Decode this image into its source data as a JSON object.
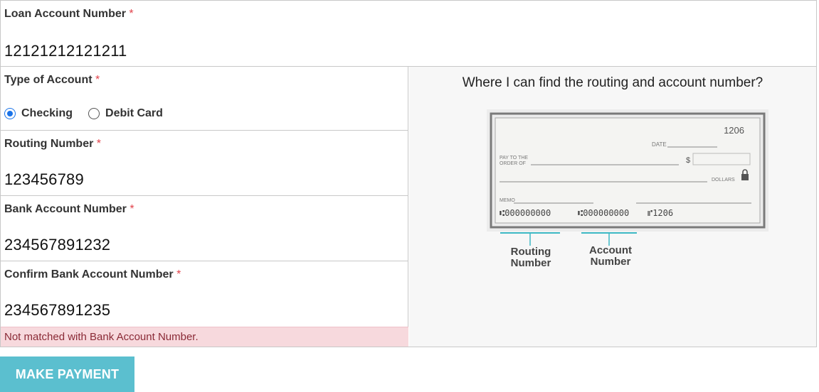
{
  "loan_account": {
    "label": "Loan Account Number",
    "required_mark": "*",
    "value": "12121212121211"
  },
  "account_type": {
    "label": "Type of Account",
    "required_mark": "*",
    "options": [
      {
        "label": "Checking",
        "checked": true
      },
      {
        "label": "Debit Card",
        "checked": false
      }
    ]
  },
  "routing": {
    "label": "Routing Number",
    "required_mark": "*",
    "value": "123456789"
  },
  "bank_account": {
    "label": "Bank Account Number",
    "required_mark": "*",
    "value": "234567891232"
  },
  "confirm_bank_account": {
    "label": "Confirm Bank Account Number",
    "required_mark": "*",
    "value": "234567891235",
    "error": "Not matched with Bank Account Number."
  },
  "help": {
    "title": "Where I can find the routing and account number?",
    "check": {
      "number": "1206",
      "date_label": "DATE",
      "pay_to_line1": "PAY TO THE",
      "pay_to_line2": "ORDER OF",
      "currency": "$",
      "dollars_label": "DOLLARS",
      "memo_label": "MEMO",
      "micr_routing": "⑆000000000",
      "micr_account": "⑆000000000",
      "micr_check": "⑈1206"
    },
    "routing_caption_1": "Routing",
    "routing_caption_2": "Number",
    "account_caption_1": "Account",
    "account_caption_2": "Number",
    "accent_color": "#3cb8c4"
  },
  "actions": {
    "make_payment_label": "MAKE PAYMENT",
    "button_color": "#5bbfcf"
  },
  "colors": {
    "required": "#e2434b",
    "radio_checked": "#1a73e8",
    "error_bg": "#f7d9dd",
    "error_text": "#8a2a36"
  }
}
